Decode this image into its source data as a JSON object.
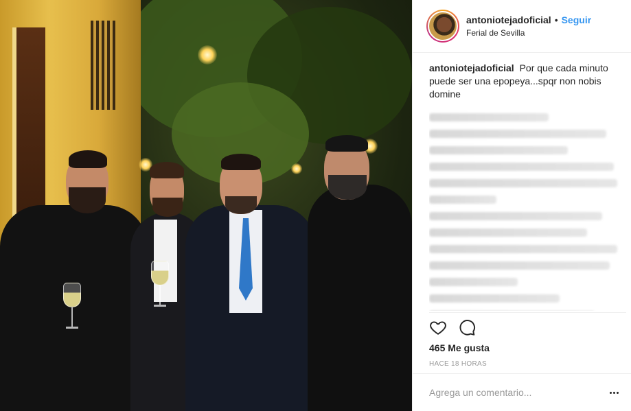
{
  "post": {
    "author": {
      "username": "antoniotejadoficial",
      "separator": "•",
      "follow_label": "Seguir",
      "location": "Ferial de Sevilla"
    },
    "caption": {
      "username": "antoniotejadoficial",
      "text": "Por que cada minuto puede ser una epopeya...spqr non nobis domine"
    },
    "likes": "465 Me gusta",
    "timestamp": "HACE 18 HORAS",
    "comment_placeholder": "Agrega un comentario...",
    "icons": {
      "like": "heart-icon",
      "comment": "comment-bubble-icon",
      "more": "more-options-icon"
    },
    "colors": {
      "accent": "#3897f0",
      "text": "#262626",
      "muted": "#999999",
      "border": "#efefef"
    }
  }
}
